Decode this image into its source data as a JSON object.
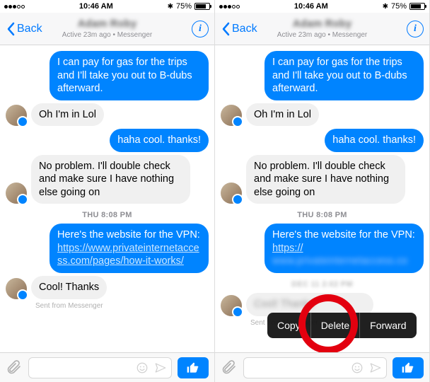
{
  "status": {
    "carrier_dots": 5,
    "carrier_filled": 3,
    "time": "10:46 AM",
    "bluetooth": "✱",
    "battery_pct": "75%"
  },
  "nav": {
    "back_label": "Back",
    "contact_name": "Adam Roby",
    "sub": "Active 23m ago • Messenger",
    "info_glyph": "i"
  },
  "timestamp": "THU 8:08 PM",
  "messages": {
    "m1": "I can pay for gas for the trips and I'll take you out to B-dubs afterward.",
    "m2": "Oh I'm in Lol",
    "m3": "haha cool. thanks!",
    "m4": "No problem. I'll double check and make sure I have nothing else going on",
    "m5a": "Here's the website for the VPN: ",
    "m5link": "https://www.privateinternetaccess.com/pages/how-it-works/",
    "m5link_short": "https://",
    "m5blur": "www.privateinternetaccess.co",
    "m6": "Cool! Thanks",
    "sent_from": "Sent from Messenger"
  },
  "context_menu": {
    "copy": "Copy",
    "delete": "Delete",
    "forward": "Forward"
  },
  "right_timestamp_blur": "DEC 11 2:02 PM"
}
